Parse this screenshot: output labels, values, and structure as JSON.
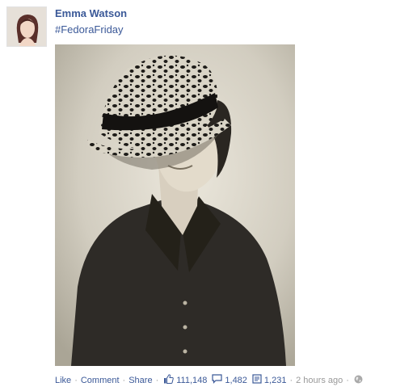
{
  "post": {
    "author": "Emma Watson",
    "text": "#FedoraFriday"
  },
  "actions": {
    "like": "Like",
    "comment": "Comment",
    "share": "Share",
    "separator": "·",
    "likes_count": "111,148",
    "comments_count": "1,482",
    "shares_count": "1,231",
    "timestamp": "2 hours ago"
  },
  "icons": {
    "like": "thumbs-up-icon",
    "comment": "comment-bubble-icon",
    "share": "share-icon",
    "privacy": "globe-icon"
  },
  "colors": {
    "link": "#3b5998",
    "meta": "#999999"
  }
}
